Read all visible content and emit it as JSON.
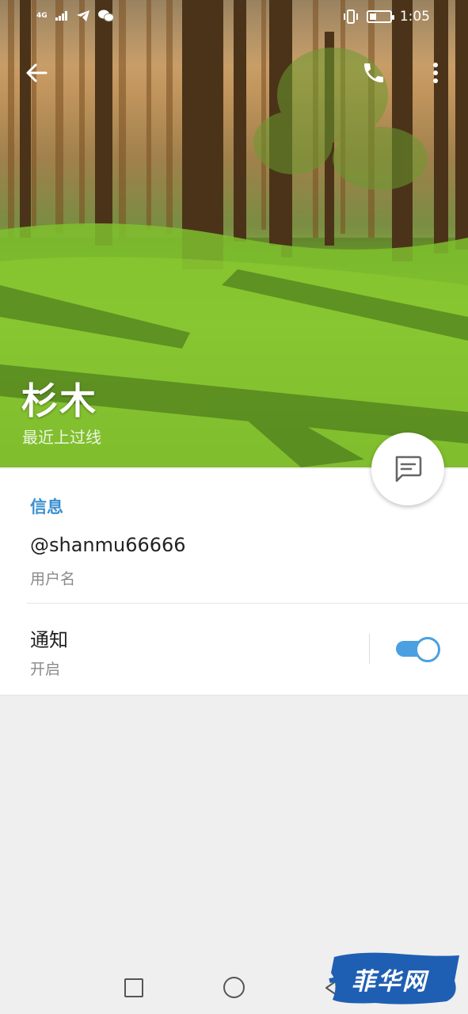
{
  "status_bar": {
    "network": "4G",
    "time": "1:05"
  },
  "contact": {
    "name": "杉木",
    "last_seen": "最近上过线"
  },
  "info_section": {
    "title": "信息",
    "username_value": "@shanmu66666",
    "username_label": "用户名",
    "notifications_label": "通知",
    "notifications_status": "开启",
    "notifications_on": true
  },
  "icons": {
    "back": "arrow-left-icon",
    "call": "phone-icon",
    "more": "more-vertical-icon",
    "message": "message-icon"
  },
  "colors": {
    "accent": "#3a8fce",
    "toggle": "#4aa0e0",
    "watermark_bg": "#1f5fb3"
  },
  "watermark": {
    "text": "菲华网"
  }
}
